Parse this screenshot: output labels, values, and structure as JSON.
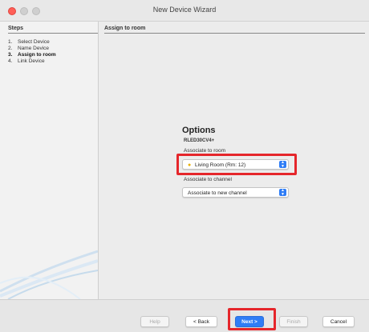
{
  "window": {
    "title": "New Device Wizard"
  },
  "sidebar": {
    "heading": "Steps",
    "steps": [
      {
        "num": "1.",
        "label": "Select Device"
      },
      {
        "num": "2.",
        "label": "Name Device"
      },
      {
        "num": "3.",
        "label": "Assign to room"
      },
      {
        "num": "4.",
        "label": "Link Device"
      }
    ],
    "active_step": 3
  },
  "main": {
    "heading": "Assign to room",
    "options_title": "Options",
    "device_code": "RLED30CV4+",
    "room_label": "Associate to room",
    "room_value": "Living Room (Rm: 12)",
    "channel_label": "Associate to channel",
    "channel_value": "Associate to new channel"
  },
  "footer": {
    "help": "Help",
    "back": "< Back",
    "next": "Next >",
    "finish": "Finish",
    "cancel": "Cancel"
  },
  "colors": {
    "highlight": "#e5262b",
    "accent": "#2f7df6"
  }
}
